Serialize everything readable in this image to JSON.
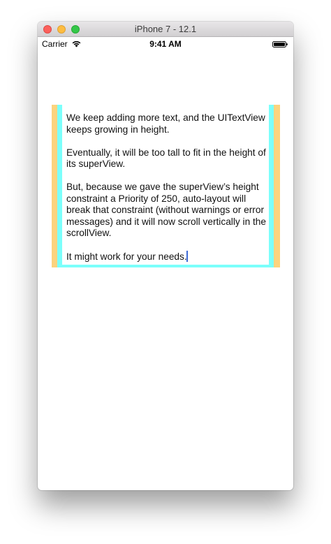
{
  "window": {
    "title": "iPhone 7 - 12.1"
  },
  "status_bar": {
    "carrier": "Carrier",
    "time": "9:41 AM",
    "wifi_icon": "wifi-icon",
    "battery_icon": "battery-icon"
  },
  "colors": {
    "outer_view": "#fbd37e",
    "super_view": "#7bfffb",
    "text_view": "#ffffff",
    "caret": "#3e6bd6"
  },
  "text_view": {
    "paragraphs": [
      "We keep adding more text, and the UITextView keeps growing in height.",
      "Eventually, it will be too tall to fit in the height of its superView.",
      "But, because we gave the superView’s height constraint a Priority of 250, auto-layout will break that constraint (without warnings or error messages) and it will now scroll vertically in the scrollView.",
      "It might work for your needs."
    ]
  }
}
